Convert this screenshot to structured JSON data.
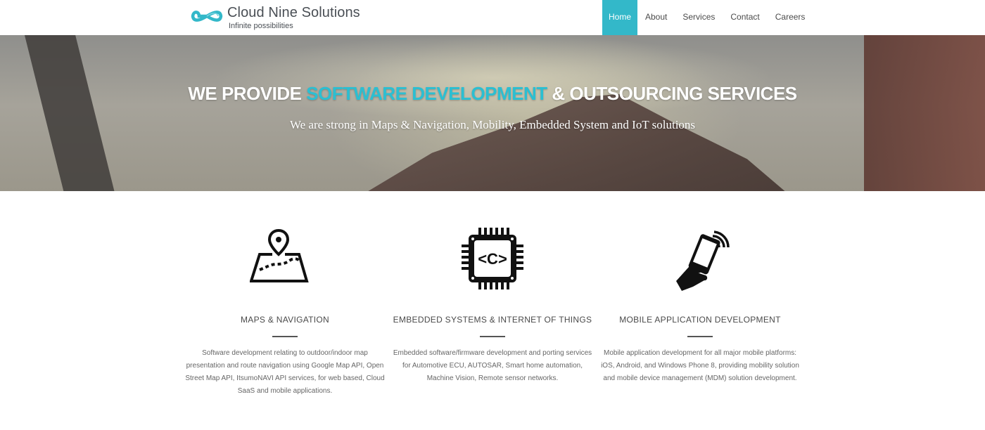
{
  "brand": {
    "name": "Cloud Nine Solutions",
    "tagline": "Infinite possibilities",
    "logo_icon": "infinity-icon",
    "accent_color": "#33b8c9"
  },
  "nav": {
    "items": [
      {
        "label": "Home",
        "active": true
      },
      {
        "label": "About",
        "active": false
      },
      {
        "label": "Services",
        "active": false
      },
      {
        "label": "Contact",
        "active": false
      },
      {
        "label": "Careers",
        "active": false
      }
    ]
  },
  "hero": {
    "title_before": "WE PROVIDE ",
    "title_accent": "SOFTWARE DEVELOPMENT",
    "title_after": " & OUTSOURCING SERVICES",
    "subtitle": "We are strong in Maps & Navigation, Mobility, Embedded System and IoT solutions",
    "accent_color": "#2bbfd2"
  },
  "features": [
    {
      "icon": "map-pin-icon",
      "title": "MAPS & NAVIGATION",
      "description": "Software development relating to outdoor/indoor map presentation and route navigation using Google Map API, Open Street Map API, ItsumoNAVI API services, for web based, Cloud SaaS and mobile applications."
    },
    {
      "icon": "chip-icon",
      "title": "EMBEDDED SYSTEMS & INTERNET OF THINGS",
      "description": "Embedded software/firmware development and porting services for Automotive ECU, AUTOSAR, Smart home automation, Machine Vision, Remote sensor networks."
    },
    {
      "icon": "mobile-phone-icon",
      "title": "MOBILE APPLICATION DEVELOPMENT",
      "description": "Mobile application development for all major mobile platforms: iOS, Android, and Windows Phone 8, providing mobility solution and mobile device management (MDM) solution development."
    }
  ]
}
